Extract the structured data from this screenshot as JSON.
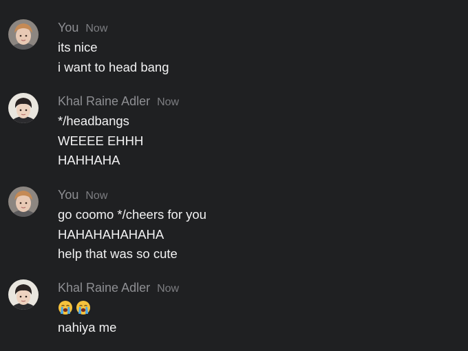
{
  "messages": [
    {
      "author": "You",
      "time": "Now",
      "lines": [
        "its nice",
        "i want to head bang"
      ]
    },
    {
      "author": "Khal Raine Adler",
      "time": "Now",
      "lines": [
        "*/headbangs",
        "WEEEE EHHH",
        "HAHHAHA"
      ]
    },
    {
      "author": "You",
      "time": "Now",
      "lines": [
        "go coomo */cheers for you",
        "HAHAHAHAHAHA",
        "help that was so cute"
      ]
    },
    {
      "author": "Khal Raine Adler",
      "time": "Now",
      "emoji": [
        "loudly-crying-face",
        "loudly-crying-face"
      ],
      "lines": [
        "nahiya me"
      ]
    }
  ],
  "colors": {
    "background": "#1f2022",
    "author": "#8e8f93",
    "text": "#f2f2f3"
  }
}
